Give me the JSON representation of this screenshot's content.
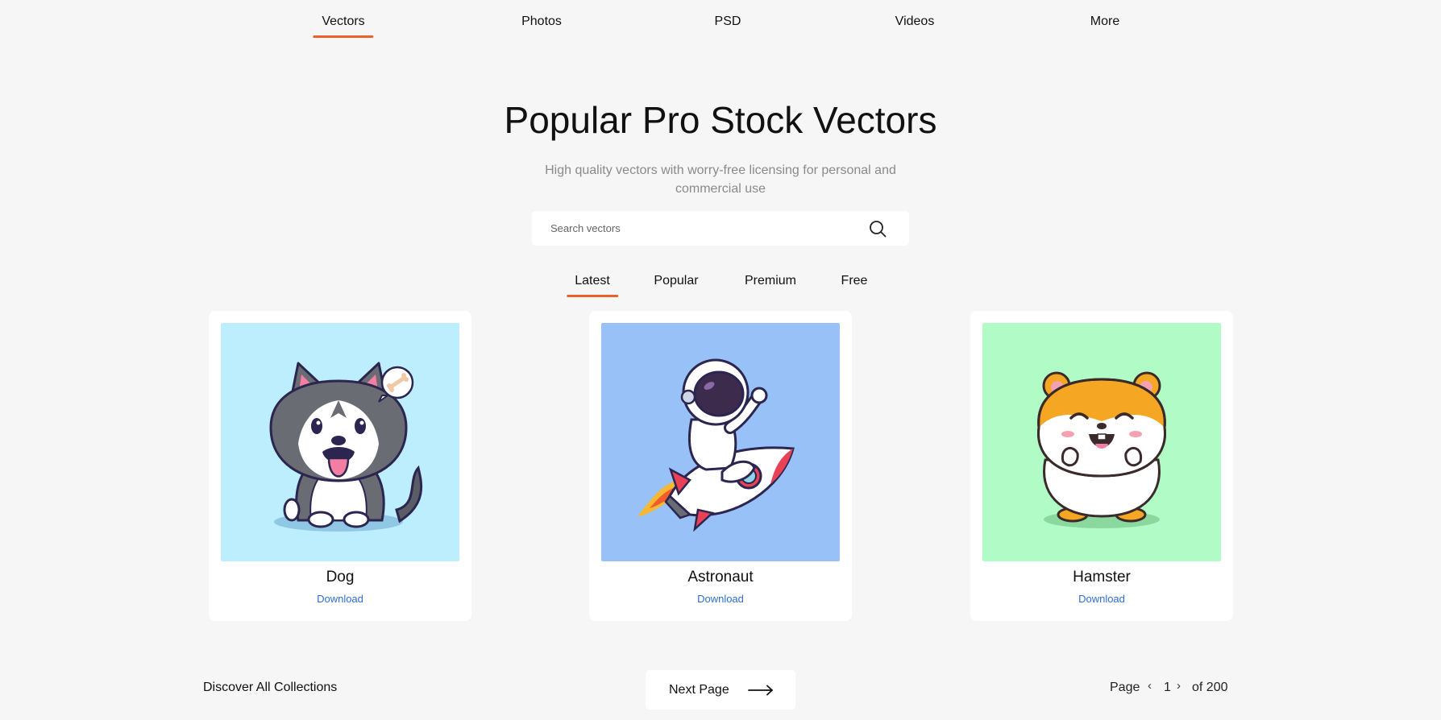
{
  "topnav": {
    "items": [
      {
        "label": "Vectors",
        "active": true
      },
      {
        "label": "Photos",
        "active": false
      },
      {
        "label": "PSD",
        "active": false
      },
      {
        "label": "Videos",
        "active": false
      },
      {
        "label": "More",
        "active": false
      }
    ]
  },
  "hero": {
    "title": "Popular Pro Stock Vectors",
    "subtitle": "High quality vectors with worry-free licensing for personal and commercial use"
  },
  "search": {
    "placeholder": "Search vectors",
    "value": "",
    "icon": "search-icon"
  },
  "filters": {
    "tabs": [
      {
        "label": "Latest",
        "active": true
      },
      {
        "label": "Popular",
        "active": false
      },
      {
        "label": "Premium",
        "active": false
      },
      {
        "label": "Free",
        "active": false
      }
    ]
  },
  "cards": [
    {
      "title": "Dog",
      "download_label": "Download",
      "bg": "#bdeefd",
      "illustration": "husky-illustration"
    },
    {
      "title": "Astronaut",
      "download_label": "Download",
      "bg": "#98c1f8",
      "illustration": "astronaut-illustration"
    },
    {
      "title": "Hamster",
      "download_label": "Download",
      "bg": "#b1fbc6",
      "illustration": "hamster-illustration"
    }
  ],
  "footer": {
    "discover_label": "Discover All Collections",
    "next_label": "Next Page",
    "page_label": "Page",
    "current_page": "1",
    "total_label": "of 200"
  },
  "colors": {
    "accent": "#e8622a",
    "link": "#2f6fd0",
    "background": "#f5f6f5"
  }
}
